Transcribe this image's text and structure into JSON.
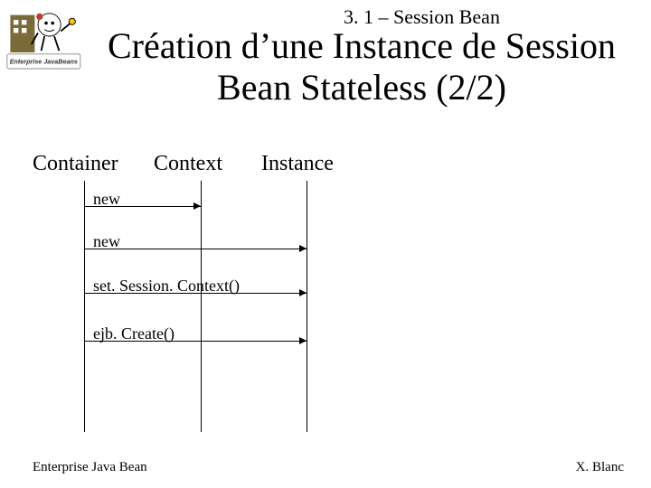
{
  "breadcrumb": "3. 1 – Session Bean",
  "title": "Création d’une Instance de Session Bean Stateless (2/2)",
  "logo_caption": "Enterprise JavaBeans",
  "lifelines": {
    "container": "Container",
    "context": "Context",
    "instance": "Instance"
  },
  "messages": {
    "m1": "new",
    "m2": "new",
    "m3": "set. Session. Context()",
    "m4": "ejb. Create()"
  },
  "footer": {
    "left": "Enterprise Java Bean",
    "right": "X. Blanc"
  },
  "chart_data": {
    "type": "sequence-diagram",
    "lifelines": [
      "Container",
      "Context",
      "Instance"
    ],
    "messages": [
      {
        "from": "Container",
        "to": "Context",
        "label": "new"
      },
      {
        "from": "Container",
        "to": "Instance",
        "label": "new"
      },
      {
        "from": "Container",
        "to": "Instance",
        "label": "setSessionContext()"
      },
      {
        "from": "Container",
        "to": "Instance",
        "label": "ejbCreate()"
      }
    ]
  }
}
